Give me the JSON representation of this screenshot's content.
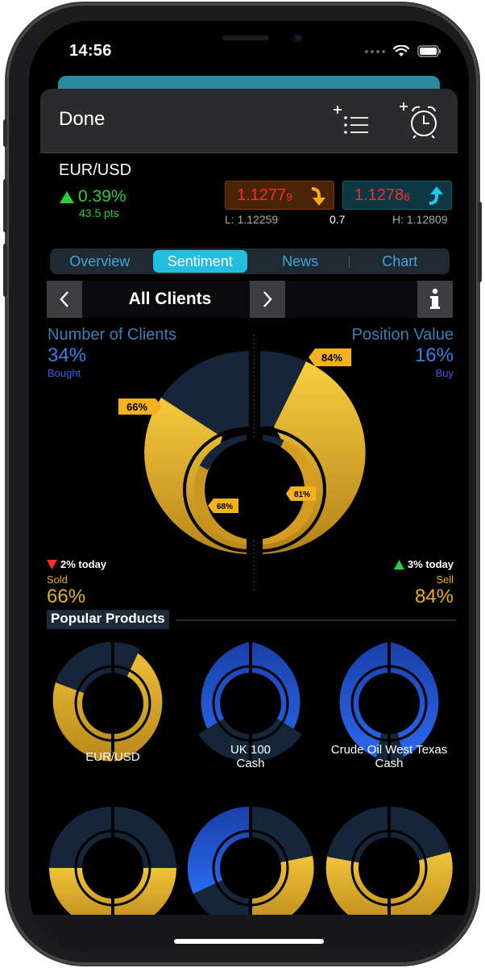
{
  "status": {
    "time": "14:56"
  },
  "nav": {
    "done_label": "Done",
    "list_icon": "add-to-list-icon",
    "alarm_icon": "add-alarm-icon"
  },
  "instrument": {
    "pair": "EUR/USD",
    "change_pct": "0.39%",
    "change_pts": "43.5 pts",
    "sell_price_main": "1.1277",
    "sell_price_small": "9",
    "buy_price_main": "1.1278",
    "buy_price_small": "6",
    "low": "L: 1.12259",
    "spread": "0.7",
    "high": "H: 1.12809"
  },
  "tabs": [
    "Overview",
    "Sentiment",
    "News",
    "Chart"
  ],
  "active_tab": "Sentiment",
  "client_bar": {
    "title": "All Clients",
    "info_icon": "info-icon"
  },
  "sentiment": {
    "left_title": "Number of Clients",
    "left_pct": "34%",
    "left_sub": "Bought",
    "right_title": "Position Value",
    "right_pct": "16%",
    "right_sub": "Buy",
    "outer_left_tag": "66%",
    "inner_left_tag": "68%",
    "outer_right_tag": "84%",
    "inner_right_tag": "81%",
    "sold_today": "2% today",
    "sold_label": "Sold",
    "sold_pct": "66%",
    "sell_today": "3% today",
    "sell_label": "Sell",
    "sell_pct": "84%",
    "colors": {
      "gold": "#e9b42c",
      "navy": "#15253a",
      "blue": "#1f5ae8"
    }
  },
  "popular": {
    "title": "Popular Products",
    "products": [
      {
        "name": "EUR/USD",
        "name2": ""
      },
      {
        "name": "UK 100",
        "name2": "Cash"
      },
      {
        "name": "Crude Oil West Texas",
        "name2": "Cash"
      }
    ]
  }
}
